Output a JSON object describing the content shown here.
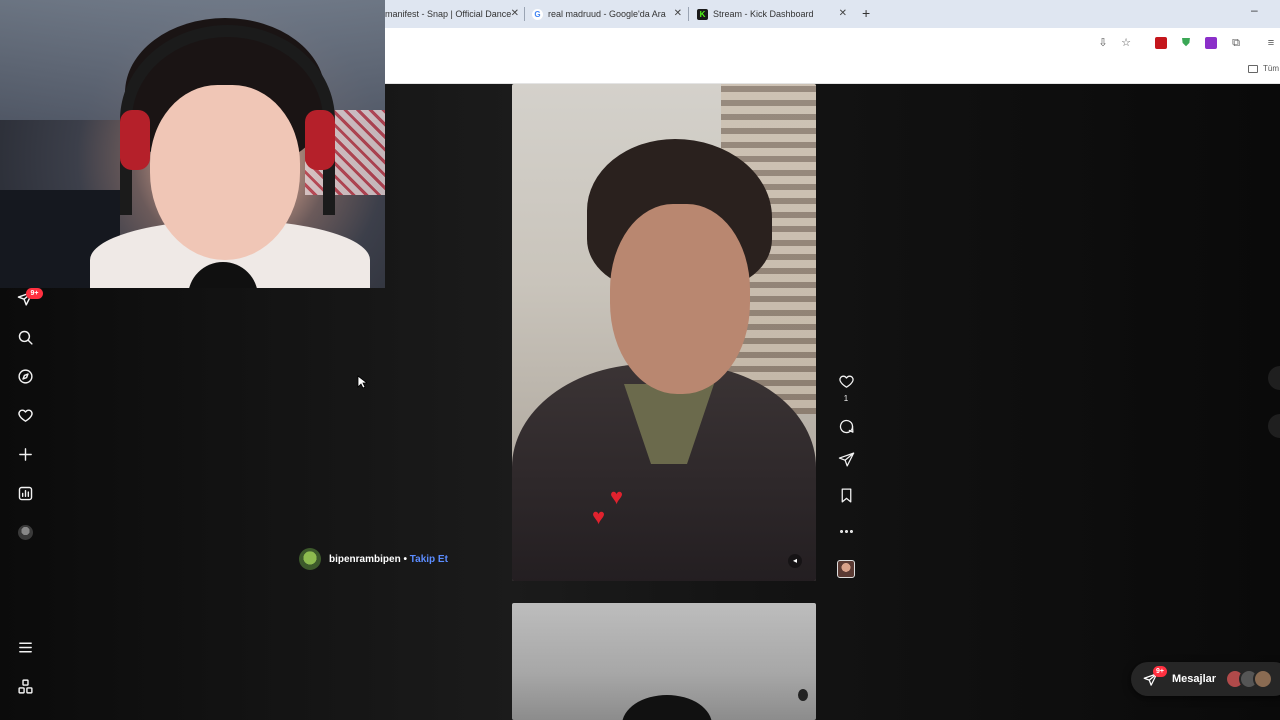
{
  "browser": {
    "tabs": [
      {
        "title": "manifest - Snap | Official Dance",
        "favicon": "none"
      },
      {
        "title": "real madruud - Google'da Ara",
        "favicon": "google-icon"
      },
      {
        "title": "Stream - Kick Dashboard",
        "favicon": "kick-icon"
      }
    ],
    "bookmarks_folder": "Tüm"
  },
  "sidebar": {
    "notification_badge": "9+",
    "items": [
      "messages-icon",
      "search-icon",
      "explore-icon",
      "heart-icon",
      "create-icon",
      "dashboard-icon",
      "profile-avatar",
      "menu-icon",
      "apps-icon"
    ]
  },
  "reel": {
    "author": "bipenrambipen",
    "separator": "•",
    "follow_label": "Takip Et",
    "like_count": "1"
  },
  "messages": {
    "label": "Mesajlar",
    "badge": "9+"
  },
  "colors": {
    "follow": "#5b8cff",
    "badge": "#ff3040",
    "background": "#0a0a0a"
  }
}
